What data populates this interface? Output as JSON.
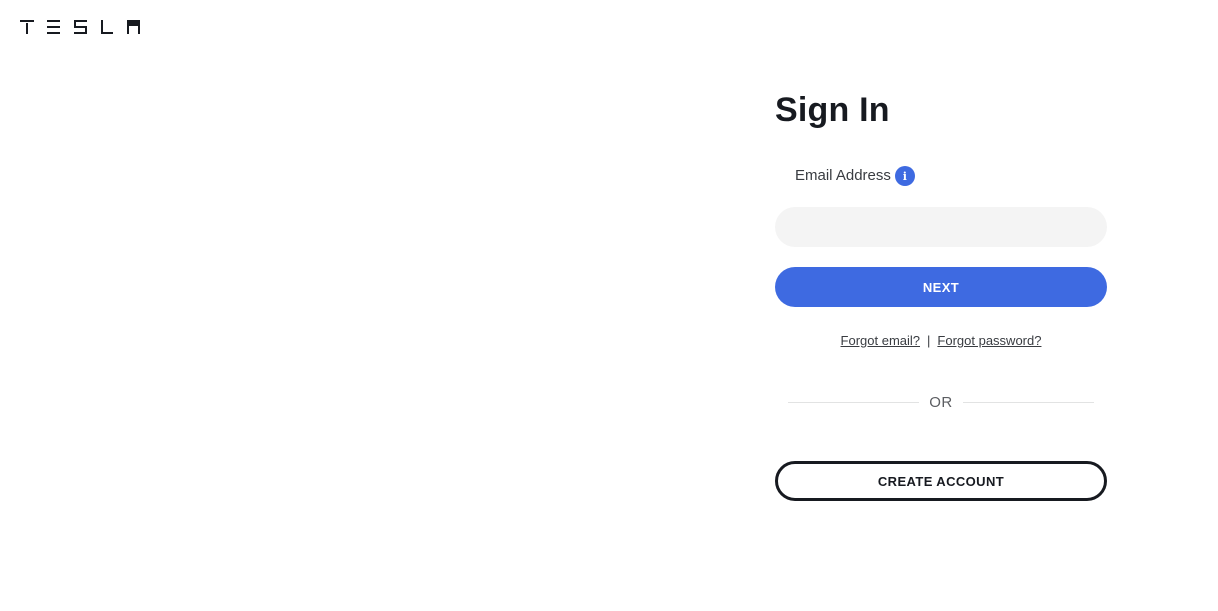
{
  "header": {
    "logo_text": "TESLA",
    "logo_icon": "tesla-wordmark-icon"
  },
  "signin": {
    "title": "Sign In",
    "email_label": "Email Address",
    "info_icon": "info-icon",
    "info_glyph": "i",
    "email_value": "",
    "email_placeholder": "",
    "next_label": "NEXT",
    "forgot_email": "Forgot email?",
    "separator": "|",
    "forgot_password": "Forgot password?",
    "or_text": "OR",
    "create_account_label": "CREATE ACCOUNT"
  },
  "colors": {
    "primary": "#3e6ae1",
    "text": "#171a20",
    "input_bg": "#f4f4f4",
    "divider": "#e2e3e3"
  }
}
